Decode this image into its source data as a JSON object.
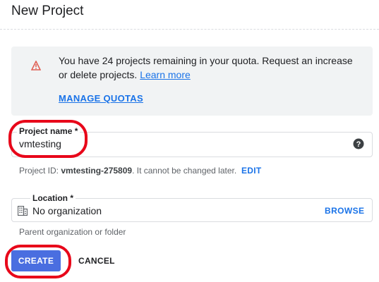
{
  "dialog": {
    "title": "New Project"
  },
  "notice": {
    "icon": "warning-triangle-icon",
    "message": "You have 24 projects remaining in your quota. Request an increase or delete projects.",
    "learn_more": "Learn more",
    "manage_quotas": "MANAGE QUOTAS"
  },
  "project_name": {
    "label": "Project name *",
    "value": "vmtesting",
    "help_icon": "help-icon"
  },
  "project_id": {
    "prefix": "Project ID:",
    "id": "vmtesting-275809",
    "suffix": ". It cannot be changed later.",
    "edit_label": "EDIT"
  },
  "location": {
    "label": "Location *",
    "value": "No organization",
    "browse_label": "BROWSE",
    "helper": "Parent organization or folder",
    "icon": "organization-icon"
  },
  "actions": {
    "create_label": "CREATE",
    "cancel_label": "CANCEL"
  },
  "colors": {
    "accent": "#1a73e8",
    "primary_button": "#4a6ee0",
    "highlight": "#e8071a",
    "warning": "#e06055"
  }
}
